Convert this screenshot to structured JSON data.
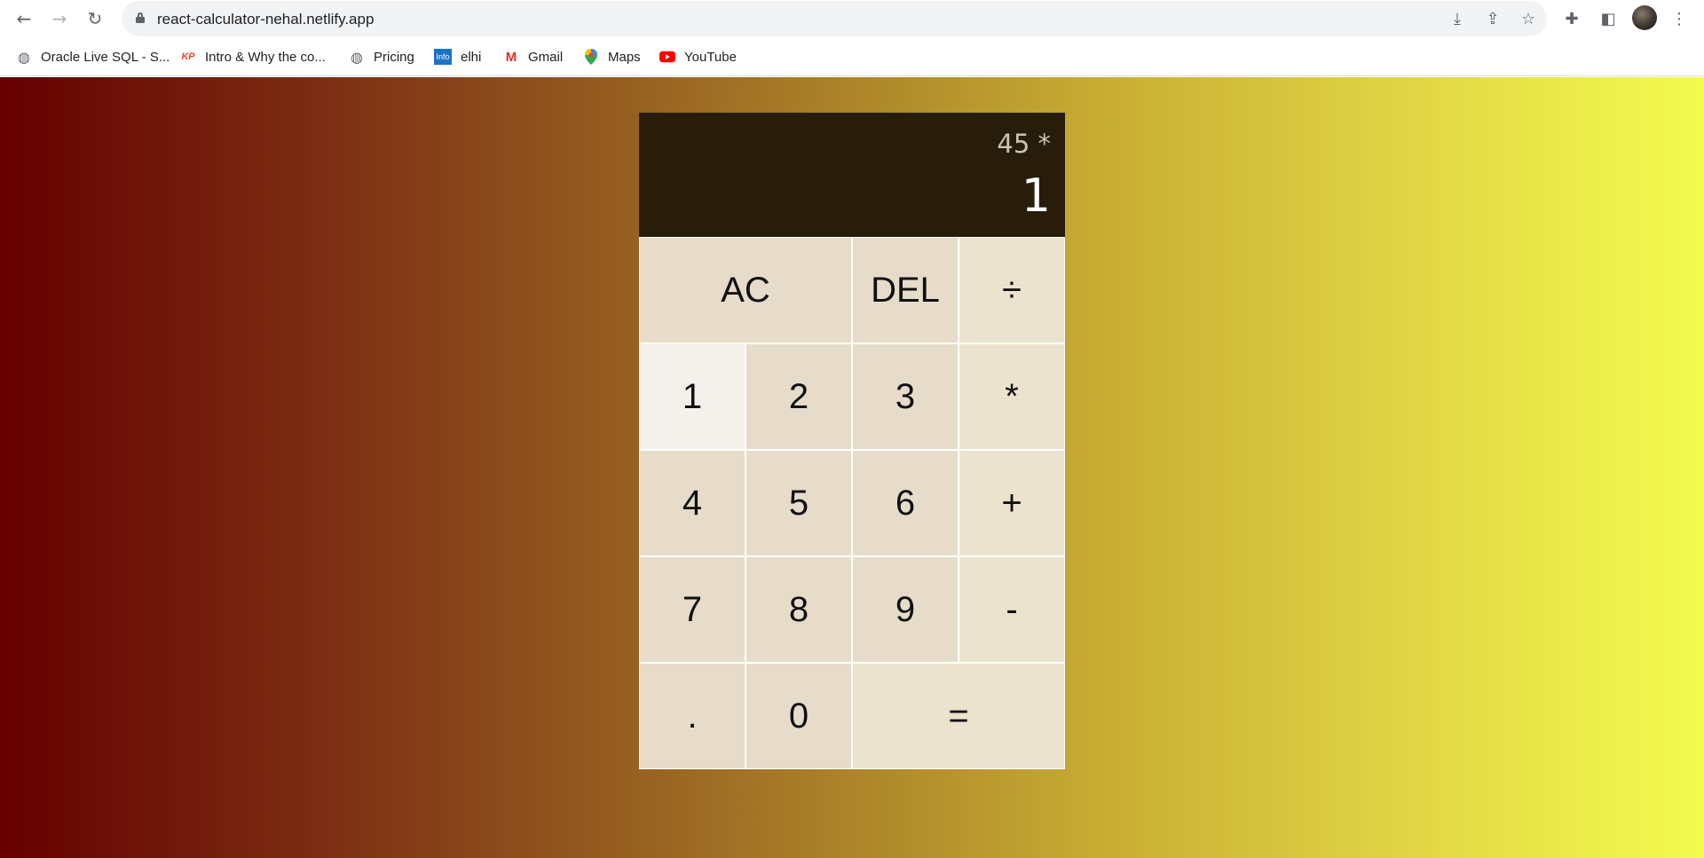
{
  "browser": {
    "url": "react-calculator-nehal.netlify.app",
    "icons": {
      "back": "arrow-left-icon",
      "forward": "arrow-right-icon",
      "reload": "reload-icon",
      "lock": "lock-icon",
      "install": "install-icon",
      "share": "share-icon",
      "bookmark": "star-icon",
      "extensions": "puzzle-icon",
      "side_panel": "side-panel-icon",
      "menu": "kebab-menu-icon"
    }
  },
  "bookmarks": [
    {
      "label": "Oracle Live SQL - S...",
      "icon": "globe-icon",
      "icon_text": ""
    },
    {
      "label": "Intro & Why the co...",
      "icon": "kp-icon",
      "icon_text": "KP"
    },
    {
      "label": "Pricing",
      "icon": "globe-icon",
      "icon_text": ""
    },
    {
      "label": "elhi",
      "icon": "info-icon",
      "icon_text": "Info"
    },
    {
      "label": "Gmail",
      "icon": "gmail-icon",
      "icon_text": "M"
    },
    {
      "label": "Maps",
      "icon": "maps-icon",
      "icon_text": ""
    },
    {
      "label": "YouTube",
      "icon": "youtube-icon",
      "icon_text": ""
    }
  ],
  "calculator": {
    "previous_operand": "45 *",
    "current_operand": "1",
    "keys": {
      "ac": "AC",
      "del": "DEL",
      "divide": "÷",
      "k1": "1",
      "k2": "2",
      "k3": "3",
      "multiply": "*",
      "k4": "4",
      "k5": "5",
      "k6": "6",
      "plus": "+",
      "k7": "7",
      "k8": "8",
      "k9": "9",
      "minus": "-",
      "dot": ".",
      "k0": "0",
      "equals": "="
    }
  },
  "colors": {
    "display_bg": "#281c0b",
    "key_bg": "#e7dcc9",
    "gradient_start": "#660000",
    "gradient_end": "#f3fb4e"
  }
}
